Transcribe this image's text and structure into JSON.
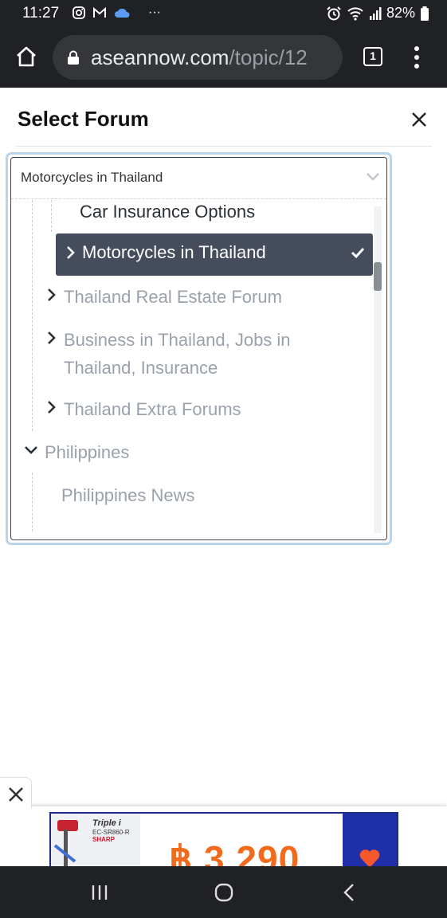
{
  "status_bar": {
    "time": "11:27",
    "left_icons": [
      "instagram-icon",
      "gmail-icon",
      "cloud-icon"
    ],
    "more": "···",
    "battery": "82%"
  },
  "browser": {
    "url_domain": "aseannow.com",
    "url_path": "/topic/12",
    "tab_count": "1"
  },
  "modal": {
    "title": "Select Forum",
    "select": {
      "value": "Motorcycles in Thailand"
    },
    "tree": {
      "items": [
        {
          "label": "Car Insurance Options"
        },
        {
          "label": "Motorcycles in Thailand",
          "selected": true
        },
        {
          "label": "Thailand Real Estate Forum"
        },
        {
          "label_line1": "Business in Thailand, Jobs in",
          "label_line2": "Thailand, Insurance"
        },
        {
          "label": "Thailand Extra Forums"
        },
        {
          "label": "Philippines",
          "expanded": true
        },
        {
          "label": "Philippines News"
        }
      ]
    }
  },
  "ad": {
    "brand": "Triple i",
    "model": "EC-SR860-R",
    "maker": "SHARP",
    "price": "฿ 3,290",
    "colors": {
      "border": "#1d2c8a",
      "price": "#f26b1d",
      "panel": "#1f2fa8"
    }
  },
  "colors": {
    "selected_bg": "#454c5b",
    "select_focus_ring": "#b7d5ec",
    "muted_text": "#9aa1ab"
  }
}
